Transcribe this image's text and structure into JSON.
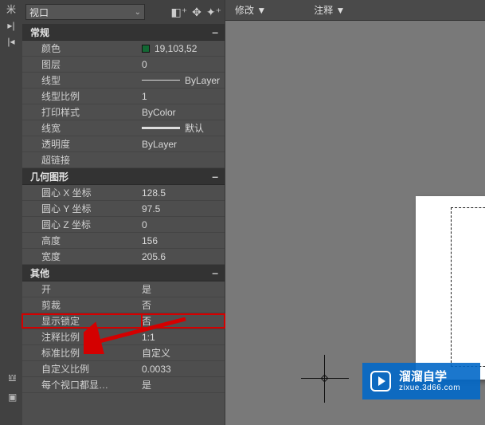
{
  "selector": {
    "label": "视口"
  },
  "ribbon": {
    "group1": "修改 ▼",
    "group2": "注释 ▼"
  },
  "cats": [
    {
      "name": "常规",
      "rows": [
        {
          "label": "颜色",
          "value": "19,103,52",
          "swatch": true
        },
        {
          "label": "图层",
          "value": "0"
        },
        {
          "label": "线型",
          "value": "ByLayer",
          "line": "thin"
        },
        {
          "label": "线型比例",
          "value": "1"
        },
        {
          "label": "打印样式",
          "value": "ByColor"
        },
        {
          "label": "线宽",
          "value": "默认",
          "line": "thick"
        },
        {
          "label": "透明度",
          "value": "ByLayer"
        },
        {
          "label": "超链接",
          "value": ""
        }
      ]
    },
    {
      "name": "几何图形",
      "rows": [
        {
          "label": "圆心 X 坐标",
          "value": "128.5"
        },
        {
          "label": "圆心 Y 坐标",
          "value": "97.5"
        },
        {
          "label": "圆心 Z 坐标",
          "value": "0"
        },
        {
          "label": "高度",
          "value": "156"
        },
        {
          "label": "宽度",
          "value": "205.6"
        }
      ]
    },
    {
      "name": "其他",
      "rows": [
        {
          "label": "开",
          "value": "是"
        },
        {
          "label": "剪裁",
          "value": "否"
        },
        {
          "label": "显示锁定",
          "value": "否",
          "highlight": true
        },
        {
          "label": "注释比例",
          "value": "1:1"
        },
        {
          "label": "标准比例",
          "value": "自定义"
        },
        {
          "label": "自定义比例",
          "value": "0.0033"
        },
        {
          "label": "每个视口都显…",
          "value": "是"
        }
      ]
    }
  ],
  "watermark": {
    "title": "溜溜自学",
    "domain": "zixue.3d66.com"
  }
}
